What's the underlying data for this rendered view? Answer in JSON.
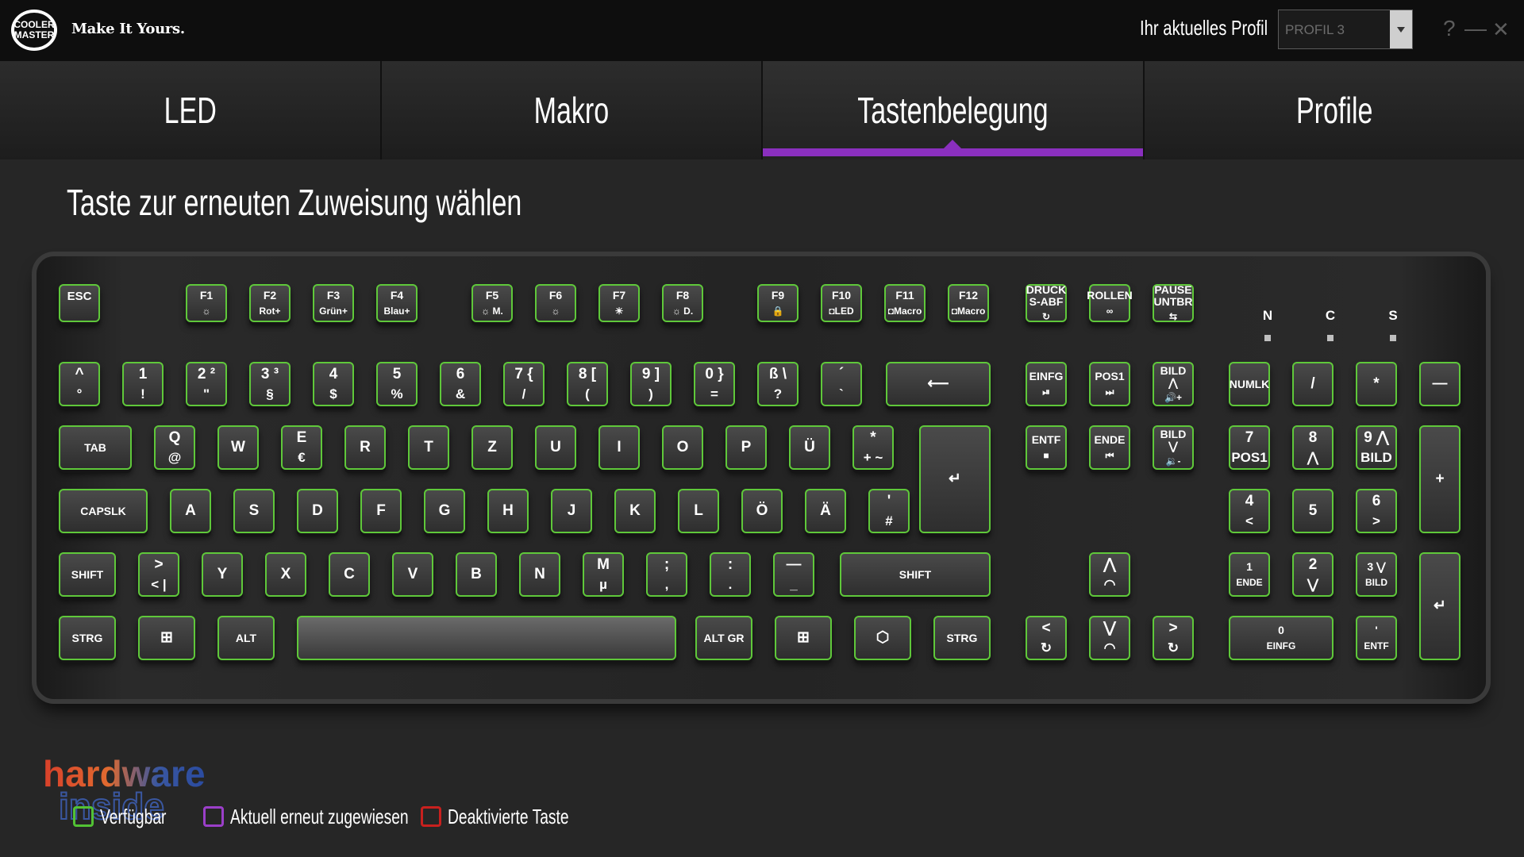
{
  "header": {
    "brand": "COOLER MASTER",
    "slogan": "Make It Yours.",
    "profile_label": "Ihr aktuelles Profil",
    "profile_value": "PROFIL 3",
    "help": "?",
    "minimize": "—",
    "close": "✕"
  },
  "tabs": [
    {
      "label": "LED"
    },
    {
      "label": "Makro"
    },
    {
      "label": "Tastenbelegung"
    },
    {
      "label": "Profile"
    }
  ],
  "heading": "Taste zur erneuten Zuweisung wählen",
  "indicators": [
    "N",
    "C",
    "S"
  ],
  "keys": [
    {
      "l1": "ESC",
      "l2": ""
    },
    {
      "l1": "F1",
      "l2": "☼"
    },
    {
      "l1": "F2",
      "l2": "Rot+"
    },
    {
      "l1": "F3",
      "l2": "Grün+"
    },
    {
      "l1": "F4",
      "l2": "Blau+"
    },
    {
      "l1": "F5",
      "l2": "☼ M."
    },
    {
      "l1": "F6",
      "l2": "☼"
    },
    {
      "l1": "F7",
      "l2": "☀"
    },
    {
      "l1": "F8",
      "l2": "☼ D."
    },
    {
      "l1": "F9",
      "l2": "🔒"
    },
    {
      "l1": "F10",
      "l2": "◘LED"
    },
    {
      "l1": "F11",
      "l2": "◘Macro"
    },
    {
      "l1": "F12",
      "l2": "◘Macro"
    },
    {
      "l1": "DRUCK S-ABF",
      "l2": "↻"
    },
    {
      "l1": "ROLLEN",
      "l2": "∞"
    },
    {
      "l1": "PAUSE UNTBR",
      "l2": "⇆"
    },
    {
      "l1": "^",
      "l2": "°"
    },
    {
      "l1": "1",
      "l2": "!"
    },
    {
      "l1": "2  ²",
      "l2": "\""
    },
    {
      "l1": "3  ³",
      "l2": "§"
    },
    {
      "l1": "4",
      "l2": "$"
    },
    {
      "l1": "5",
      "l2": "%"
    },
    {
      "l1": "6",
      "l2": "&"
    },
    {
      "l1": "7  {",
      "l2": "/"
    },
    {
      "l1": "8  [",
      "l2": "("
    },
    {
      "l1": "9  ]",
      "l2": ")"
    },
    {
      "l1": "0  }",
      "l2": "="
    },
    {
      "l1": "ß  \\",
      "l2": "?"
    },
    {
      "l1": "´",
      "l2": "`"
    },
    {
      "l1": "⟵",
      "l2": ""
    },
    {
      "l1": "EINFG",
      "l2": "⏯"
    },
    {
      "l1": "POS1",
      "l2": "⏭"
    },
    {
      "l1": "BILD ⋀",
      "l2": "🔊+"
    },
    {
      "l1": "NUMLK",
      "l2": ""
    },
    {
      "l1": "/",
      "l2": ""
    },
    {
      "l1": "*",
      "l2": ""
    },
    {
      "l1": "—",
      "l2": ""
    },
    {
      "l1": "TAB",
      "l2": ""
    },
    {
      "l1": "Q",
      "l2": "@"
    },
    {
      "l1": "W",
      "l2": ""
    },
    {
      "l1": "E",
      "l2": "€"
    },
    {
      "l1": "R",
      "l2": ""
    },
    {
      "l1": "T",
      "l2": ""
    },
    {
      "l1": "Z",
      "l2": ""
    },
    {
      "l1": "U",
      "l2": ""
    },
    {
      "l1": "I",
      "l2": ""
    },
    {
      "l1": "O",
      "l2": ""
    },
    {
      "l1": "P",
      "l2": ""
    },
    {
      "l1": "Ü",
      "l2": ""
    },
    {
      "l1": "*",
      "l2": "+  ~"
    },
    {
      "l1": "↵",
      "l2": ""
    },
    {
      "l1": "ENTF",
      "l2": "■"
    },
    {
      "l1": "ENDE",
      "l2": "⏮"
    },
    {
      "l1": "BILD ⋁",
      "l2": "🔉-"
    },
    {
      "l1": "7",
      "l2": "POS1"
    },
    {
      "l1": "8",
      "l2": "⋀"
    },
    {
      "l1": "9 ⋀",
      "l2": "BILD"
    },
    {
      "l1": "+",
      "l2": ""
    },
    {
      "l1": "CAPSLK",
      "l2": ""
    },
    {
      "l1": "A",
      "l2": ""
    },
    {
      "l1": "S",
      "l2": ""
    },
    {
      "l1": "D",
      "l2": ""
    },
    {
      "l1": "F",
      "l2": ""
    },
    {
      "l1": "G",
      "l2": ""
    },
    {
      "l1": "H",
      "l2": ""
    },
    {
      "l1": "J",
      "l2": ""
    },
    {
      "l1": "K",
      "l2": ""
    },
    {
      "l1": "L",
      "l2": ""
    },
    {
      "l1": "Ö",
      "l2": ""
    },
    {
      "l1": "Ä",
      "l2": ""
    },
    {
      "l1": "'",
      "l2": "#"
    },
    {
      "l1": "4",
      "l2": "<"
    },
    {
      "l1": "5",
      "l2": ""
    },
    {
      "l1": "6",
      "l2": ">"
    },
    {
      "l1": "SHIFT",
      "l2": ""
    },
    {
      "l1": ">",
      "l2": "<  |"
    },
    {
      "l1": "Y",
      "l2": ""
    },
    {
      "l1": "X",
      "l2": ""
    },
    {
      "l1": "C",
      "l2": ""
    },
    {
      "l1": "V",
      "l2": ""
    },
    {
      "l1": "B",
      "l2": ""
    },
    {
      "l1": "N",
      "l2": ""
    },
    {
      "l1": "M",
      "l2": "µ"
    },
    {
      "l1": ";",
      "l2": ","
    },
    {
      "l1": ":",
      "l2": "."
    },
    {
      "l1": "—",
      "l2": "_"
    },
    {
      "l1": "SHIFT",
      "l2": ""
    },
    {
      "l1": "⋀",
      "l2": "◠"
    },
    {
      "l1": "1",
      "l2": "ENDE"
    },
    {
      "l1": "2",
      "l2": "⋁"
    },
    {
      "l1": "3 ⋁",
      "l2": "BILD"
    },
    {
      "l1": "↵",
      "l2": ""
    },
    {
      "l1": "STRG",
      "l2": ""
    },
    {
      "l1": "⊞",
      "l2": ""
    },
    {
      "l1": "ALT",
      "l2": ""
    },
    {
      "l1": "",
      "l2": ""
    },
    {
      "l1": "ALT GR",
      "l2": ""
    },
    {
      "l1": "⊞",
      "l2": ""
    },
    {
      "l1": "⬡",
      "l2": ""
    },
    {
      "l1": "STRG",
      "l2": ""
    },
    {
      "l1": "<",
      "l2": "↻"
    },
    {
      "l1": "⋁",
      "l2": "◠"
    },
    {
      "l1": ">",
      "l2": "↻"
    },
    {
      "l1": "0",
      "l2": "EINFG"
    },
    {
      "l1": "'",
      "l2": "ENTF"
    }
  ],
  "watermark": {
    "line1": "hardware",
    "line2": "inside"
  },
  "legend": [
    {
      "label": "Verfügbar",
      "color": "#52c234"
    },
    {
      "label": "Aktuell erneut zugewiesen",
      "color": "#9b3fc9"
    },
    {
      "label": "Deaktivierte Taste",
      "color": "#c8201e"
    }
  ]
}
